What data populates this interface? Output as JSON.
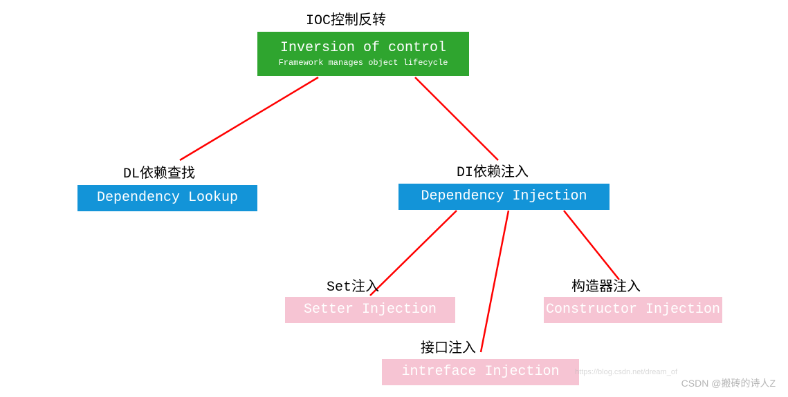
{
  "root": {
    "label": "IOC控制反转",
    "box_title": "Inversion of control",
    "box_sub": "Framework manages object lifecycle"
  },
  "dl": {
    "label": "DL依赖查找",
    "box_title": "Dependency Lookup"
  },
  "di": {
    "label": "DI依赖注入",
    "box_title": "Dependency Injection"
  },
  "setter": {
    "label": "Set注入",
    "box_title": "Setter Injection"
  },
  "interface": {
    "label": "接口注入",
    "box_title": "intreface Injection"
  },
  "constructor": {
    "label": "构造器注入",
    "box_title": "Constructor Injection"
  },
  "watermark": "CSDN @搬砖的诗人Z",
  "watermark_url": "https://blog.csdn.net/dream_of"
}
